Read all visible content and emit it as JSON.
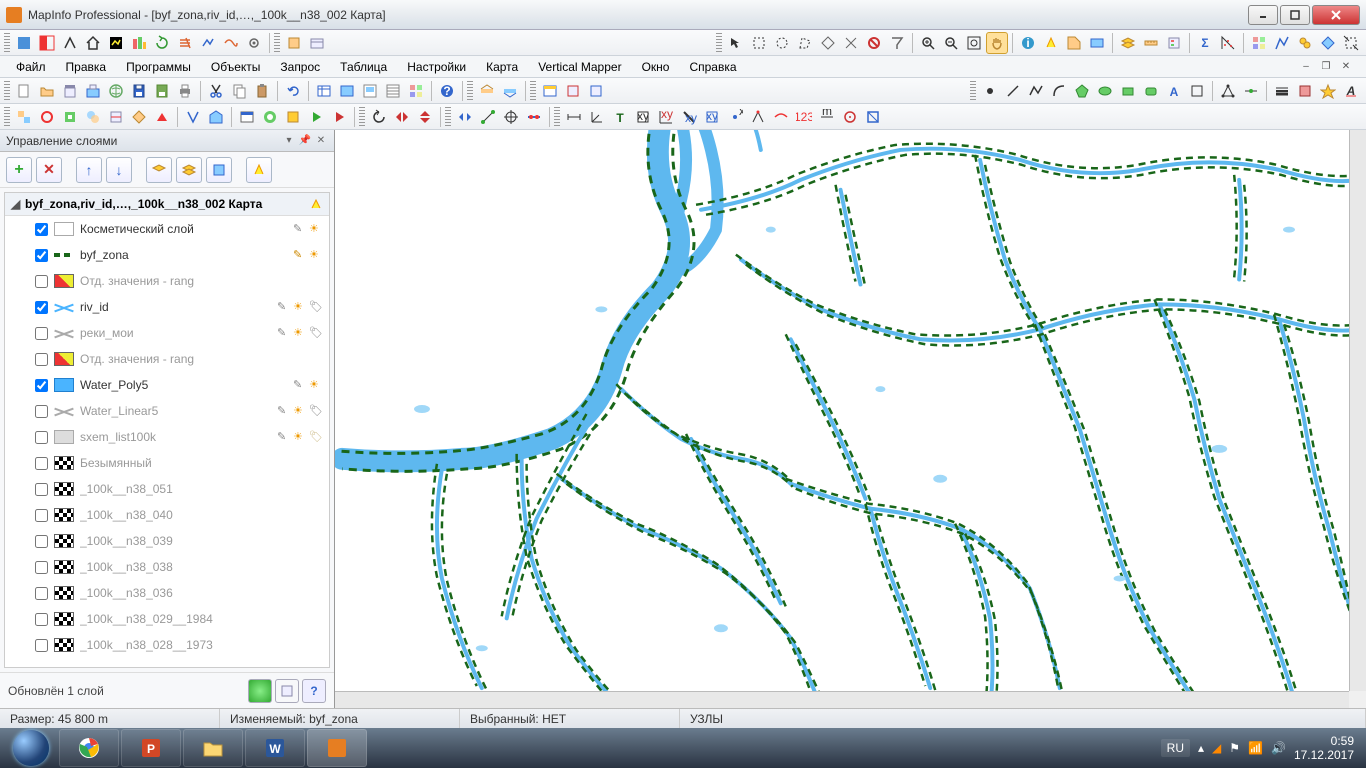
{
  "titlebar": {
    "text": "MapInfo Professional - [byf_zona,riv_id,…,_100k__n38_002 Карта]"
  },
  "menu": [
    "Файл",
    "Правка",
    "Программы",
    "Объекты",
    "Запрос",
    "Таблица",
    "Настройки",
    "Карта",
    "Vertical Mapper",
    "Окно",
    "Справка"
  ],
  "panel": {
    "title": "Управление слоями",
    "group": "byf_zona,riv_id,…,_100k__n38_002 Карта",
    "footer": "Обновлён 1 слой"
  },
  "layers": [
    {
      "name": "Косметический слой",
      "checked": true,
      "swatch": "cosmetic",
      "icons": [
        "pen",
        "sun"
      ]
    },
    {
      "name": "byf_zona",
      "checked": true,
      "swatch": "dash",
      "icons": [
        "pen",
        "sun"
      ],
      "bold": false,
      "pen_active": true
    },
    {
      "name": "Отд. значения - rang",
      "checked": false,
      "swatch": "rang",
      "grey": true
    },
    {
      "name": "riv_id",
      "checked": true,
      "swatch": "xblue",
      "icons": [
        "pen",
        "sun",
        "tag"
      ]
    },
    {
      "name": "реки_мои",
      "checked": false,
      "swatch": "xgrey",
      "grey": true,
      "icons": [
        "pen",
        "sun",
        "tag"
      ]
    },
    {
      "name": "Отд. значения - rang",
      "checked": false,
      "swatch": "rang",
      "grey": true
    },
    {
      "name": "Water_Poly5",
      "checked": true,
      "swatch": "water",
      "icons": [
        "pen",
        "sun"
      ]
    },
    {
      "name": "Water_Linear5",
      "checked": false,
      "swatch": "xgrey",
      "grey": true,
      "icons": [
        "pen",
        "sun",
        "tag"
      ]
    },
    {
      "name": "sxem_list100k",
      "checked": false,
      "swatch": "folder",
      "grey": true,
      "icons": [
        "pen",
        "sun",
        "tag"
      ],
      "tag_active": true
    },
    {
      "name": "Безымянный",
      "checked": false,
      "swatch": "checker",
      "grey": true
    },
    {
      "name": "_100k__n38_051",
      "checked": false,
      "swatch": "checker",
      "grey": true
    },
    {
      "name": "_100k__n38_040",
      "checked": false,
      "swatch": "checker",
      "grey": true
    },
    {
      "name": "_100k__n38_039",
      "checked": false,
      "swatch": "checker",
      "grey": true
    },
    {
      "name": "_100k__n38_038",
      "checked": false,
      "swatch": "checker",
      "grey": true
    },
    {
      "name": "_100k__n38_036",
      "checked": false,
      "swatch": "checker",
      "grey": true
    },
    {
      "name": "_100k__n38_029__1984",
      "checked": false,
      "swatch": "checker",
      "grey": true
    },
    {
      "name": "_100k__n38_028__1973",
      "checked": false,
      "swatch": "checker",
      "grey": true
    }
  ],
  "status": {
    "size": "Размер: 45 800 m",
    "editing": "Изменяемый: byf_zona",
    "selected": "Выбранный: НЕТ",
    "nodes": "УЗЛЫ"
  },
  "tray": {
    "lang": "RU",
    "time": "0:59",
    "date": "17.12.2017"
  }
}
